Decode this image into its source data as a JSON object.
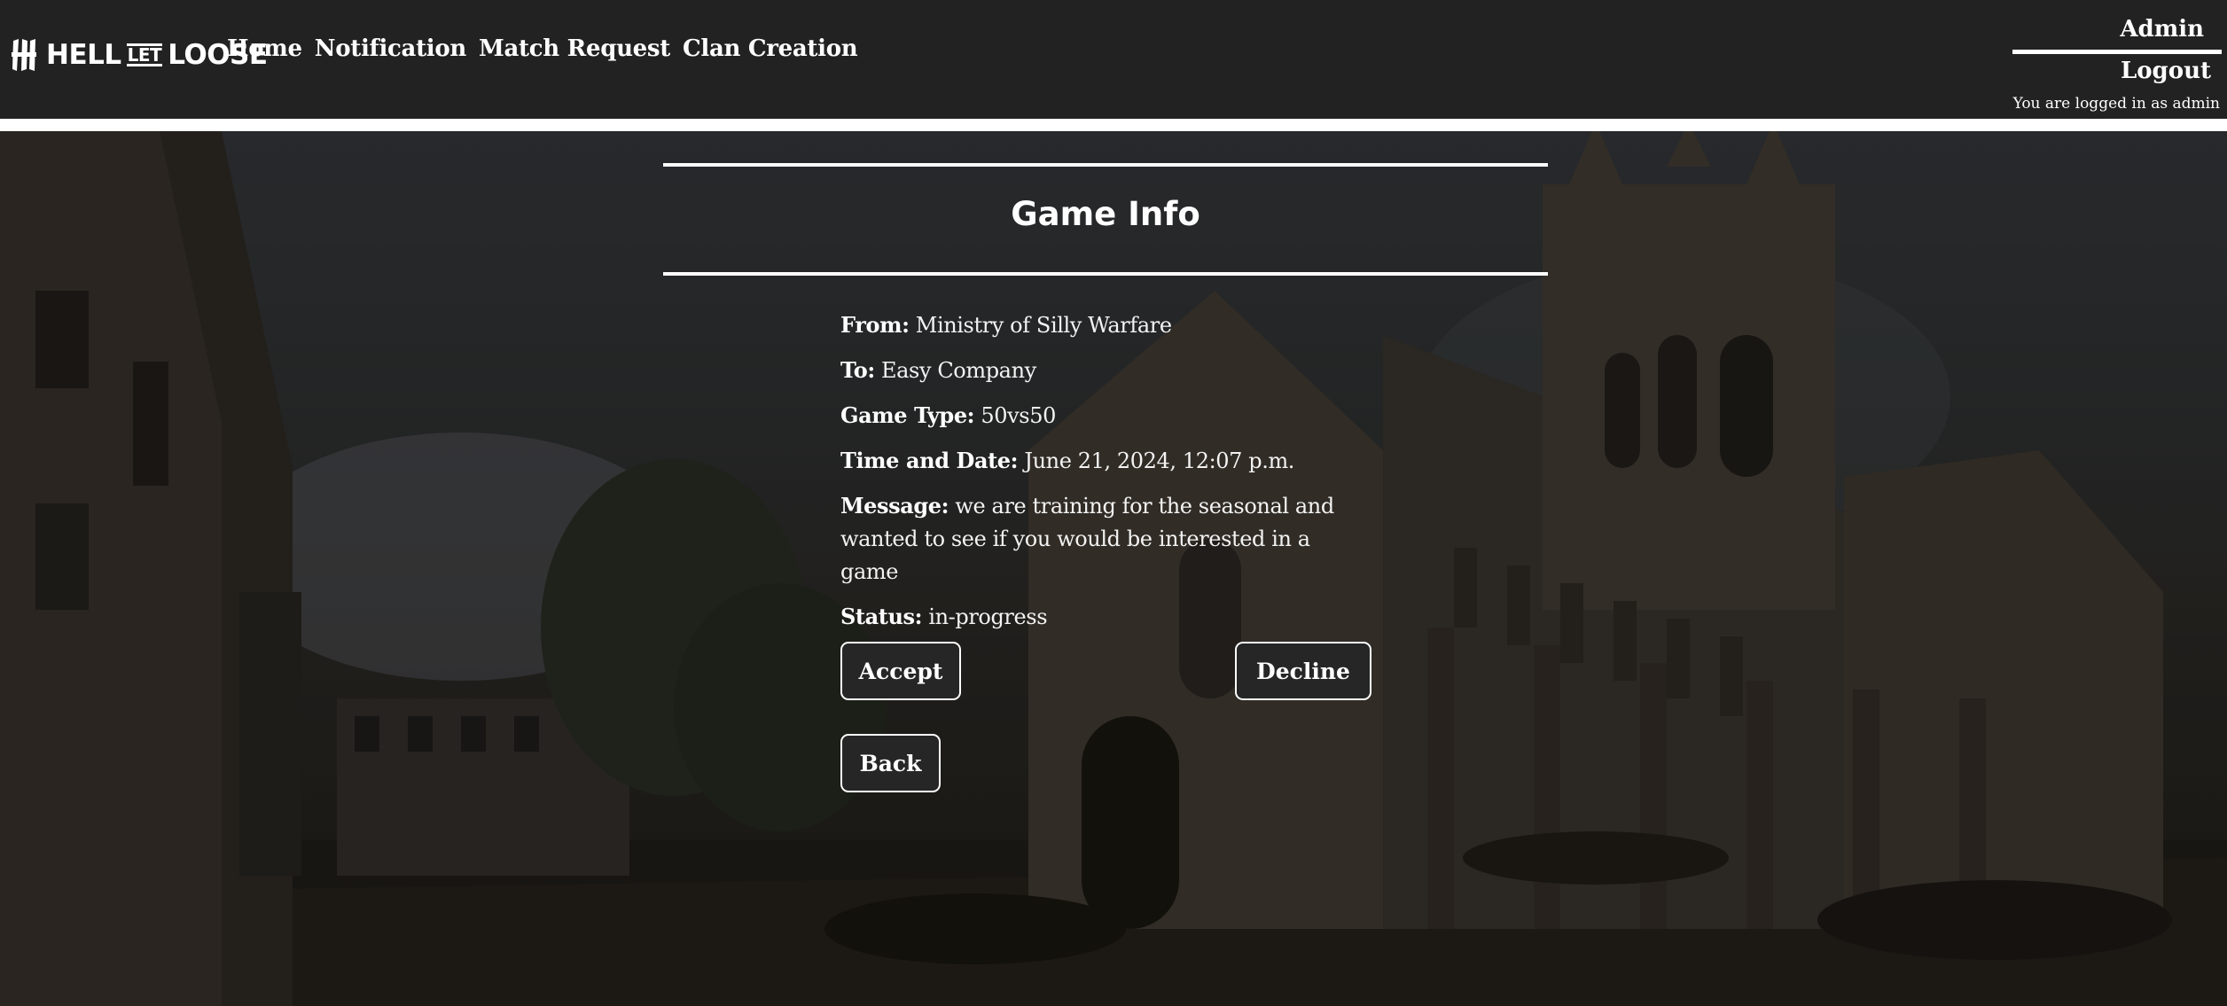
{
  "brand": {
    "logo_icon": "hll-claw-icon",
    "word_left": "HELL",
    "word_mid": "LET",
    "word_right": "LOOSE"
  },
  "nav": {
    "items": [
      {
        "label": "Home"
      },
      {
        "label": "Notification"
      },
      {
        "label": "Match Request"
      },
      {
        "label": "Clan Creation"
      }
    ]
  },
  "account": {
    "username": "Admin",
    "logout_label": "Logout",
    "logged_in_text": "You are logged in as admin"
  },
  "game_info": {
    "title": "Game Info",
    "from_label": "From:",
    "from_value": "Ministry of Silly Warfare",
    "to_label": "To:",
    "to_value": "Easy Company",
    "type_label": "Game Type:",
    "type_value": "50vs50",
    "datetime_label": "Time and Date:",
    "datetime_value": "June 21, 2024, 12:07 p.m.",
    "message_label": "Message:",
    "message_value": "we are training for the seasonal and wanted to see if you would be interested in a game",
    "status_label": "Status:",
    "status_value": "in-progress"
  },
  "actions": {
    "accept_label": "Accept",
    "decline_label": "Decline",
    "back_label": "Back"
  },
  "colors": {
    "header_bg": "#222222",
    "text": "#ffffff",
    "button_bg": "#262626"
  }
}
